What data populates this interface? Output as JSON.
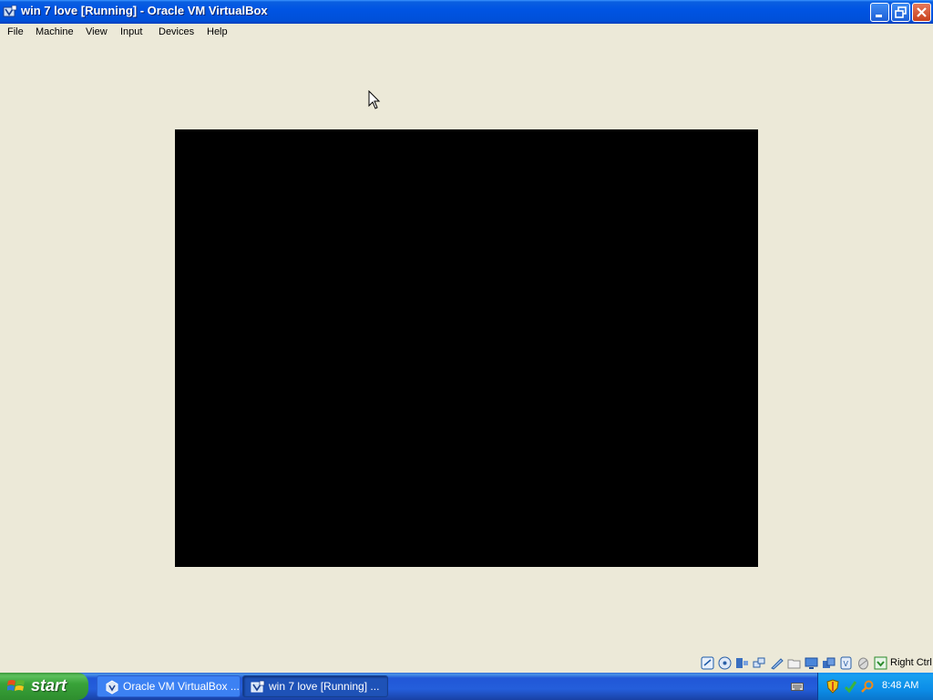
{
  "window": {
    "title": "win 7 love [Running] - Oracle VM VirtualBox",
    "app_icon": "virtualbox-icon",
    "controls": [
      "minimize-icon",
      "restore-icon",
      "close-icon"
    ]
  },
  "menu": {
    "items": [
      "File",
      "Machine",
      "View",
      "Input",
      "Devices",
      "Help"
    ]
  },
  "vm": {
    "screen_color": "#000000"
  },
  "statusbar": {
    "icons": [
      "hard-disk-icon",
      "optical-drive-icon",
      "audio-icon",
      "network-icon",
      "usb-icon",
      "shared-folders-icon",
      "display-icon",
      "video-capture-icon",
      "cpu-icon",
      "mouse-integration-icon",
      "keyboard-capture-icon",
      "host-key-icon"
    ],
    "host_key": "Right Ctrl"
  },
  "taskbar": {
    "start_label": "start",
    "tasks": [
      {
        "label": "Oracle VM VirtualBox ...",
        "icon": "virtualbox-icon",
        "active": false
      },
      {
        "label": "win 7 love [Running] ...",
        "icon": "virtualbox-vm-icon",
        "active": true
      }
    ],
    "tray_icons": [
      "keyboard-icon",
      "security-shield-icon",
      "update-icon",
      "search-icon"
    ],
    "clock": "8:48 AM"
  },
  "colors": {
    "titlebar": "#0054e3",
    "background": "#ece9d8",
    "start_button": "#3c9a3c",
    "tray": "#0f8ef0"
  }
}
